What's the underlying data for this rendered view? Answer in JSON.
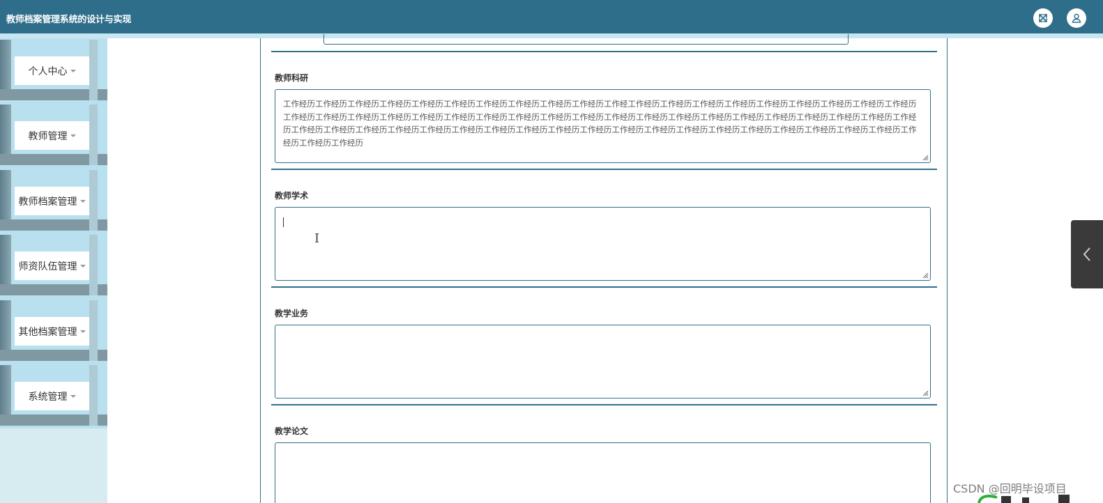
{
  "header": {
    "title": "教师档案管理系统的设计与实现",
    "fullscreen_icon": "fullscreen-icon",
    "user_icon": "user-icon",
    "bar_color": "#2e6e8a"
  },
  "sidebar": {
    "items": [
      {
        "label": "个人中心"
      },
      {
        "label": "教师管理"
      },
      {
        "label": "教师档案管理"
      },
      {
        "label": "师资队伍管理"
      },
      {
        "label": "其他档案管理"
      },
      {
        "label": "系统管理"
      }
    ]
  },
  "form": {
    "fields": [
      {
        "label": "教师科研",
        "value": "工作经历工作经历工作经历工作经历工作经历工作经历工作经历工作经历工作经历工作经历工作经工作经历工作经历工作经历工作经历工作经历工作经历工作经历工作经历工作经历工作经历工作经历工作经历工作经历工作经历工作经历工作经历工作经历工作经历工作经历工作经历工作经历工作经历工作经历工作经历工作经历工作经历工作经历工作经历工作经历工作经历工作经历工作经历工作经历工作经历工作经历工作经历工作经历工作经历工作经历工作经历工作经历工作经历工作经历工作经历工作经历工作经历工作经历工作经历工作经历工作经历工作经历"
      },
      {
        "label": "教师学术",
        "value": ""
      },
      {
        "label": "教学业务",
        "value": ""
      },
      {
        "label": "教学论文",
        "value": ""
      }
    ]
  },
  "drawer": {
    "icon": "chevron-left-icon"
  },
  "watermark": "CSDN @回明毕设项目"
}
